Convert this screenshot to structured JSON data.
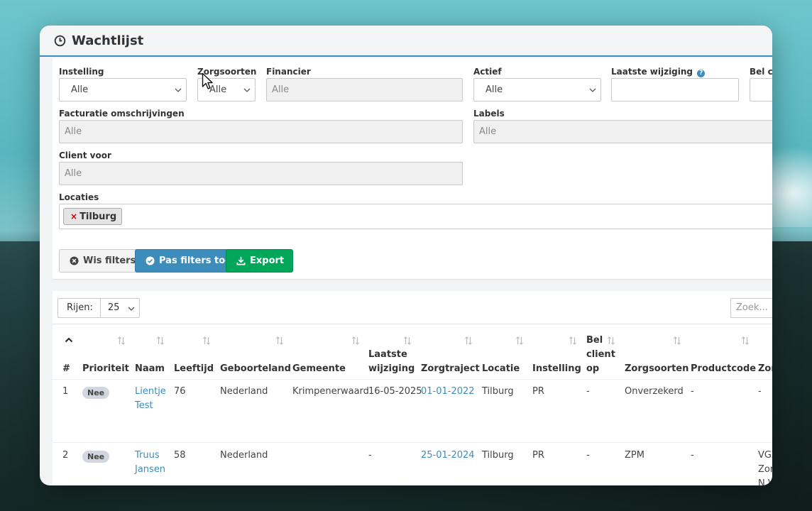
{
  "window": {
    "title": "Wachtlijst"
  },
  "filters": {
    "instelling": {
      "label": "Instelling",
      "value": "Alle"
    },
    "zorgsoorten": {
      "label": "Zorgsoorten",
      "value": "Alle"
    },
    "financier": {
      "label": "Financier",
      "placeholder": "Alle"
    },
    "actief": {
      "label": "Actief",
      "value": "Alle"
    },
    "laatste_wijziging": {
      "label": "Laatste wijziging",
      "help": "?"
    },
    "bel_client": {
      "label": "Bel cli"
    },
    "facturatie": {
      "label": "Facturatie omschrijvingen",
      "placeholder": "Alle"
    },
    "labels": {
      "label": "Labels",
      "placeholder": "Alle"
    },
    "client_voor": {
      "label": "Client voor",
      "placeholder": "Alle"
    },
    "locaties": {
      "label": "Locaties",
      "tags": [
        {
          "remove": "×",
          "text": "Tilburg"
        }
      ]
    }
  },
  "buttons": {
    "wis": "Wis filters",
    "pas": "Pas filters toe",
    "export": "Export"
  },
  "table": {
    "rows_label": "Rijen:",
    "rows_value": "25",
    "search_placeholder": "Zoek...",
    "headers": [
      "#",
      "Prioriteit",
      "Naam",
      "Leeftijd",
      "Geboorteland",
      "Gemeente",
      "Laatste\nwijziging",
      "Zorgtraject",
      "Locatie",
      "Instelling",
      "Bel\nclient\nop",
      "Zorgsoorten",
      "Productcode",
      "Zor"
    ],
    "rows": [
      {
        "nr": "1",
        "prioriteit": "Nee",
        "naam": "Lientje Test",
        "leeftijd": "76",
        "geboorteland": "Nederland",
        "gemeente": "Krimpenerwaard",
        "laatste_wijziging": "16-05-2025",
        "zorgtraject": "01-01-2022",
        "locatie": "Tilburg",
        "instelling": "PR",
        "bel_client": "-",
        "zorgsoorten": "Onverzekerd",
        "productcode": "-",
        "zor": "-"
      },
      {
        "nr": "2",
        "prioriteit": "Nee",
        "naam": "Truus Jansen",
        "leeftijd": "58",
        "geboorteland": "Nederland",
        "gemeente": "",
        "laatste_wijziging": "-",
        "zorgtraject": "25-01-2024",
        "locatie": "Tilburg",
        "instelling": "PR",
        "bel_client": "-",
        "zorgsoorten": "ZPM",
        "productcode": "-",
        "zor": "VGZ Zor N.V"
      }
    ]
  },
  "colors": {
    "primary": "#3c8dbc",
    "success": "#00a65a",
    "link": "#3c8dbc"
  },
  "icons": [
    "clock-icon",
    "chevron-down-icon",
    "times-circle-icon",
    "check-circle-icon",
    "download-icon",
    "sort-icon",
    "chevron-up-icon",
    "question-icon",
    "mouse-cursor-icon"
  ]
}
